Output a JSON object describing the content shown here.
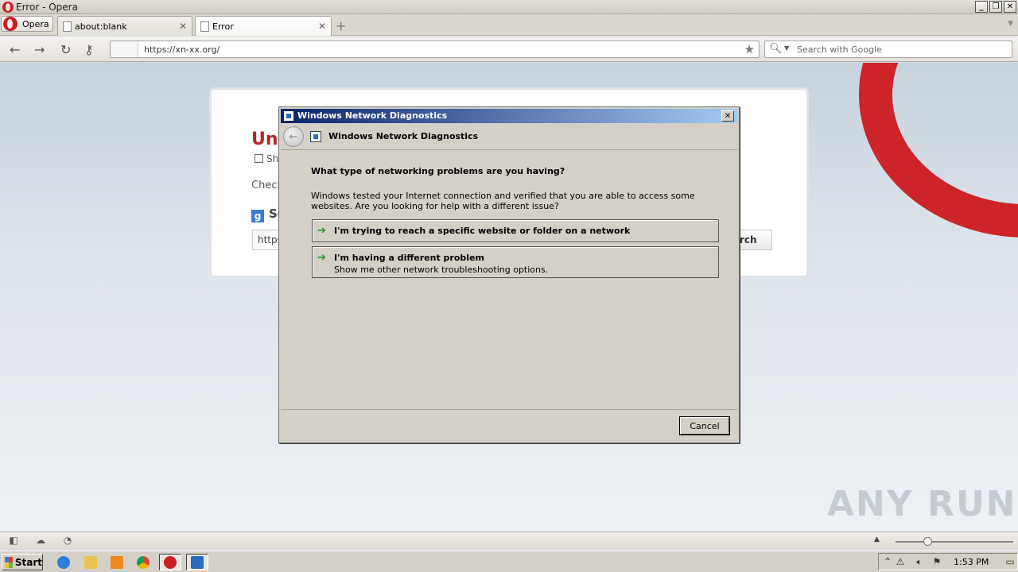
{
  "window": {
    "title": "Error - Opera",
    "controls": [
      "minimize",
      "restore",
      "close"
    ]
  },
  "tabbar": {
    "menu_label": "Opera",
    "tabs": [
      {
        "label": "about:blank",
        "active": false
      },
      {
        "label": "Error",
        "active": true
      }
    ]
  },
  "addressbar": {
    "url": "https://xn-xx.org/",
    "search_placeholder": "Search with Google"
  },
  "error_page": {
    "title": "Una",
    "show_label": "Sh",
    "check_text": "Check",
    "search_heading": "Se",
    "search_input_value": "https",
    "search_button": "rch",
    "google_icon_glyph": "g"
  },
  "watermark": "ANY RUN",
  "dialog": {
    "title": "Windows Network Diagnostics",
    "header_title": "Windows Network Diagnostics",
    "question": "What type of networking problems are you having?",
    "description": "Windows tested your Internet connection and verified that you are able to access some websites. Are you looking for help with a different issue?",
    "options": [
      {
        "title": "I'm trying to reach a specific website or folder on a network",
        "subtitle": ""
      },
      {
        "title": "I'm having a different problem",
        "subtitle": "Show me other network troubleshooting options."
      }
    ],
    "cancel_label": "Cancel"
  },
  "taskbar": {
    "start_label": "Start",
    "clock": "1:53 PM"
  },
  "colors": {
    "opera_red": "#cc1f25",
    "dialog_title_start": "#0a246a",
    "dialog_title_end": "#a6caf0",
    "option_arrow": "#1e9a1e"
  }
}
